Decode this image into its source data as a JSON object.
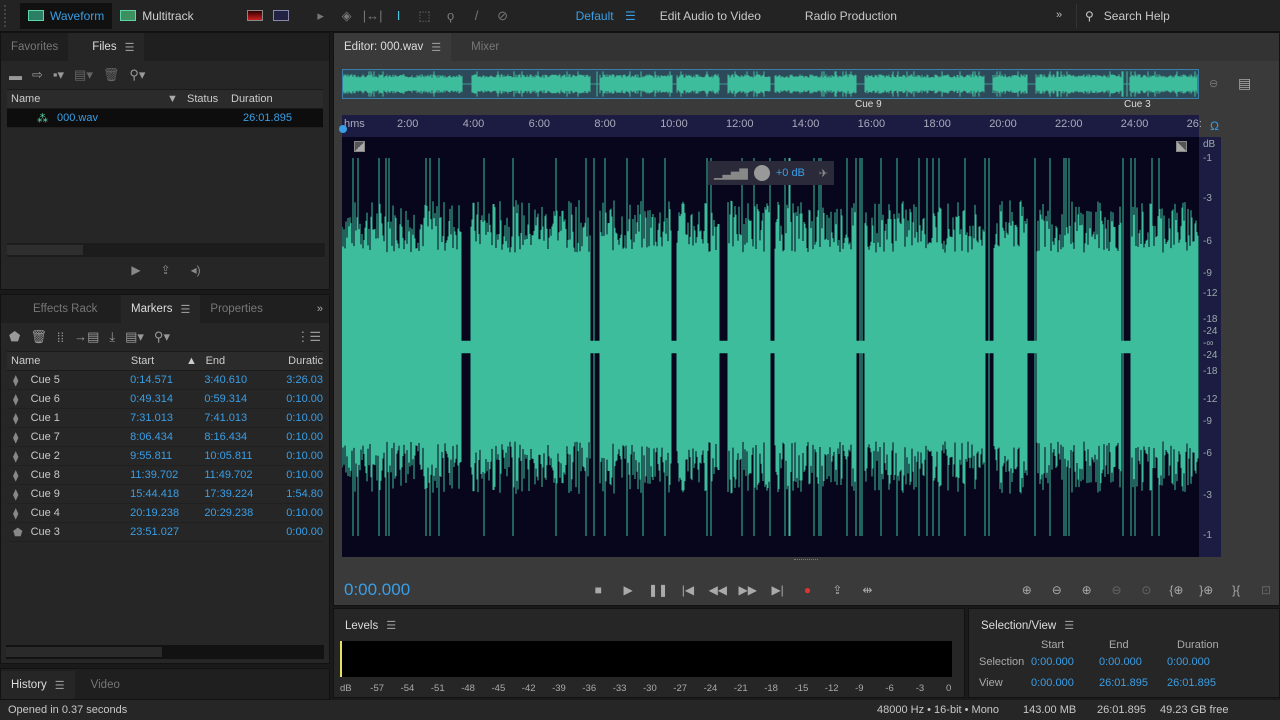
{
  "topbar": {
    "modes": [
      {
        "label": "Waveform",
        "active": true
      },
      {
        "label": "Multitrack",
        "active": false
      }
    ],
    "tools": [
      "spectral-frequency-icon",
      "spectral-pitch-icon",
      "move-tool-icon",
      "razor-tool-icon",
      "slip-tool-icon",
      "time-selection-icon",
      "marquee-icon",
      "lasso-icon",
      "brush-icon",
      "spot-healing-icon"
    ],
    "workspaces": [
      {
        "label": "Default",
        "active": true
      },
      {
        "label": "Edit Audio to Video"
      },
      {
        "label": "Radio Production"
      }
    ],
    "search_placeholder": "Search Help"
  },
  "files_panel": {
    "tabs": [
      {
        "label": "Favorites"
      },
      {
        "label": "Files",
        "active": true
      }
    ],
    "columns": [
      "Name",
      "Status",
      "Duration"
    ],
    "files": [
      {
        "name": "000.wav",
        "status": "",
        "duration": "26:01.895"
      }
    ]
  },
  "markers_panel": {
    "tabs": [
      {
        "label": "Effects Rack"
      },
      {
        "label": "Markers",
        "active": true
      },
      {
        "label": "Properties"
      }
    ],
    "columns": [
      "Name",
      "Start",
      "End",
      "Duratic"
    ],
    "rows": [
      {
        "name": "Cue 5",
        "start": "0:14.571",
        "end": "3:40.610",
        "duration": "3:26.03",
        "type": "range"
      },
      {
        "name": "Cue 6",
        "start": "0:49.314",
        "end": "0:59.314",
        "duration": "0:10.00",
        "type": "range"
      },
      {
        "name": "Cue 1",
        "start": "7:31.013",
        "end": "7:41.013",
        "duration": "0:10.00",
        "type": "range"
      },
      {
        "name": "Cue 7",
        "start": "8:06.434",
        "end": "8:16.434",
        "duration": "0:10.00",
        "type": "range"
      },
      {
        "name": "Cue 2",
        "start": "9:55.811",
        "end": "10:05.811",
        "duration": "0:10.00",
        "type": "range"
      },
      {
        "name": "Cue 8",
        "start": "11:39.702",
        "end": "11:49.702",
        "duration": "0:10.00",
        "type": "range"
      },
      {
        "name": "Cue 9",
        "start": "15:44.418",
        "end": "17:39.224",
        "duration": "1:54.80",
        "type": "range"
      },
      {
        "name": "Cue 4",
        "start": "20:19.238",
        "end": "20:29.238",
        "duration": "0:10.00",
        "type": "range"
      },
      {
        "name": "Cue 3",
        "start": "23:51.027",
        "end": "",
        "duration": "0:00.00",
        "type": "point"
      }
    ]
  },
  "history_panel": {
    "tabs": [
      {
        "label": "History",
        "active": true
      },
      {
        "label": "Video"
      }
    ]
  },
  "editor": {
    "tabs": [
      {
        "label": "Editor: 000.wav",
        "active": true
      },
      {
        "label": "Mixer"
      }
    ],
    "ruler_unit": "hms",
    "ruler_labels": [
      "2:00",
      "4:00",
      "6:00",
      "8:00",
      "10:00",
      "12:00",
      "14:00",
      "16:00",
      "18:00",
      "20:00",
      "22:00",
      "24:00",
      "26:"
    ],
    "marker_labels": [
      "Cue 9",
      "Cue 3"
    ],
    "db_labels": [
      "dB",
      "-1",
      "-3",
      "-6",
      "-9",
      "-12",
      "-18",
      "-24",
      "-∞",
      "-24",
      "-18",
      "-12",
      "-9",
      "-6",
      "-3",
      "-1"
    ],
    "hud_gain": "+0 dB",
    "time": "0:00.000"
  },
  "levels": {
    "title": "Levels",
    "scale": [
      "dB",
      "-57",
      "-54",
      "-51",
      "-48",
      "-45",
      "-42",
      "-39",
      "-36",
      "-33",
      "-30",
      "-27",
      "-24",
      "-21",
      "-18",
      "-15",
      "-12",
      "-9",
      "-6",
      "-3",
      "0"
    ]
  },
  "selection_view": {
    "title": "Selection/View",
    "columns": [
      "Start",
      "End",
      "Duration"
    ],
    "selection": {
      "label": "Selection",
      "start": "0:00.000",
      "end": "0:00.000",
      "duration": "0:00.000"
    },
    "view": {
      "label": "View",
      "start": "0:00.000",
      "end": "26:01.895",
      "duration": "26:01.895"
    }
  },
  "status": {
    "message": "Opened in 0.37 seconds",
    "format": "48000 Hz • 16-bit • Mono",
    "size": "143.00 MB",
    "duration": "26:01.895",
    "free": "49.23 GB free"
  }
}
